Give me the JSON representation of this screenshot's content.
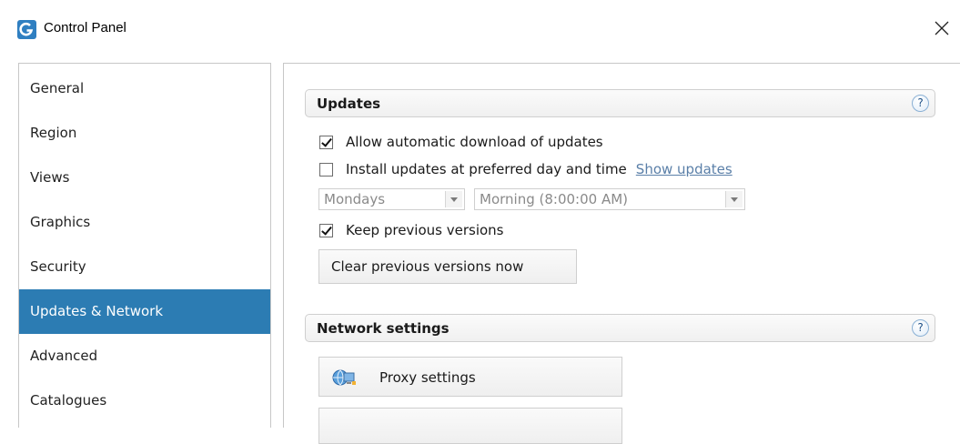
{
  "window": {
    "title": "Control Panel",
    "icon": "app-logo-icon",
    "close_icon": "close-icon"
  },
  "sidebar": {
    "items": [
      {
        "label": "General"
      },
      {
        "label": "Region"
      },
      {
        "label": "Views"
      },
      {
        "label": "Graphics"
      },
      {
        "label": "Security"
      },
      {
        "label": "Updates & Network",
        "active": true
      },
      {
        "label": "Advanced"
      },
      {
        "label": "Catalogues"
      }
    ]
  },
  "updates": {
    "title": "Updates",
    "help_icon": "help-icon",
    "auto_download": {
      "label": "Allow automatic download of updates",
      "checked": true
    },
    "install_preferred": {
      "label": "Install updates at preferred day and time",
      "checked": false
    },
    "show_updates_link": "Show updates",
    "day_select": {
      "value": "Mondays"
    },
    "time_select": {
      "value": "Morning (8:00:00 AM)"
    },
    "keep_previous": {
      "label": "Keep previous versions",
      "checked": true
    },
    "clear_button": "Clear previous versions now"
  },
  "network": {
    "title": "Network settings",
    "help_icon": "help-icon",
    "proxy_button": "Proxy settings",
    "proxy_icon": "network-globe-icon"
  },
  "colors": {
    "accent": "#2c7cb3",
    "link": "#5a7fa8"
  }
}
